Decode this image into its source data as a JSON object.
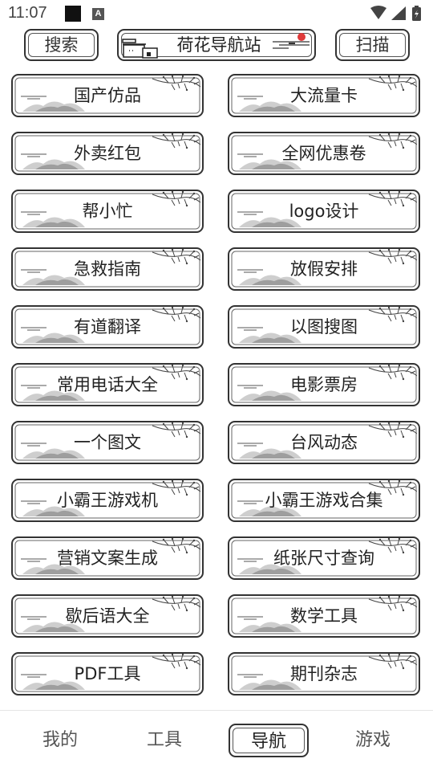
{
  "status_bar": {
    "time": "11:07",
    "icons": [
      "square-notification-icon",
      "a-badge-icon",
      "wifi-icon",
      "signal-icon",
      "battery-icon"
    ],
    "a_badge": "A"
  },
  "header": {
    "search_label": "搜索",
    "title": "荷花导航站",
    "scan_label": "扫描"
  },
  "grid": {
    "items": [
      {
        "label": "国产仿品"
      },
      {
        "label": "大流量卡"
      },
      {
        "label": "外卖红包"
      },
      {
        "label": "全网优惠卷"
      },
      {
        "label": "帮小忙"
      },
      {
        "label": "logo设计"
      },
      {
        "label": "急救指南"
      },
      {
        "label": "放假安排"
      },
      {
        "label": "有道翻译"
      },
      {
        "label": "以图搜图"
      },
      {
        "label": "常用电话大全"
      },
      {
        "label": "电影票房"
      },
      {
        "label": "一个图文"
      },
      {
        "label": "台风动态"
      },
      {
        "label": "小霸王游戏机"
      },
      {
        "label": "小霸王游戏合集"
      },
      {
        "label": "营销文案生成"
      },
      {
        "label": "纸张尺寸查询"
      },
      {
        "label": "歇后语大全"
      },
      {
        "label": "数学工具"
      },
      {
        "label": "PDF工具"
      },
      {
        "label": "期刊杂志"
      },
      {
        "label": ""
      },
      {
        "label": ""
      }
    ]
  },
  "bottom_nav": {
    "items": [
      {
        "label": "我的",
        "active": false
      },
      {
        "label": "工具",
        "active": false
      },
      {
        "label": "导航",
        "active": true
      },
      {
        "label": "游戏",
        "active": false
      }
    ]
  },
  "colors": {
    "frame": "#333333",
    "mountain": "#9a9a9a",
    "seal": "#e03a3a"
  }
}
